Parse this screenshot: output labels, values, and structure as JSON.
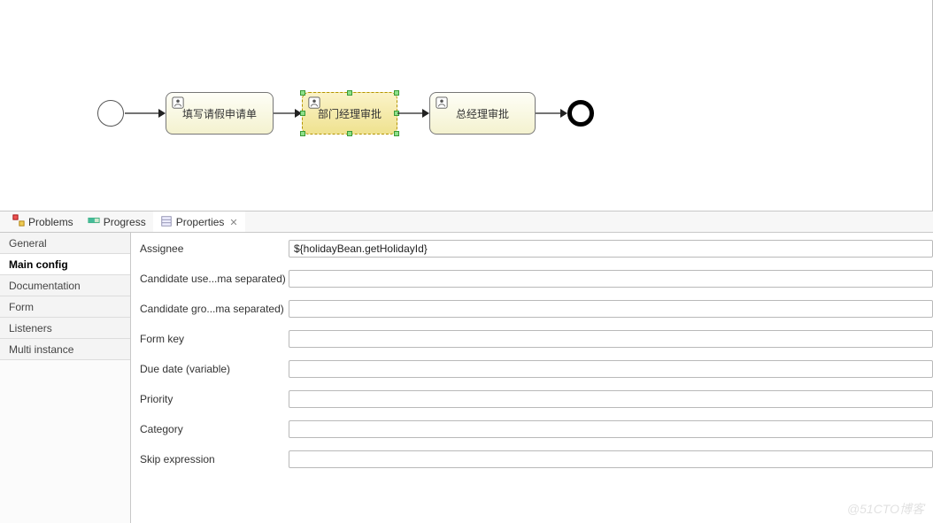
{
  "diagram": {
    "tasks": [
      {
        "id": "t1",
        "label": "填写请假申请单",
        "selected": false
      },
      {
        "id": "t2",
        "label": "部门经理审批",
        "selected": true
      },
      {
        "id": "t3",
        "label": "总经理审批",
        "selected": false
      }
    ]
  },
  "tabs": [
    {
      "id": "problems",
      "label": "Problems",
      "icon": "problems-icon"
    },
    {
      "id": "progress",
      "label": "Progress",
      "icon": "progress-icon"
    },
    {
      "id": "properties",
      "label": "Properties",
      "icon": "properties-icon",
      "active": true,
      "closable": true
    }
  ],
  "sidebar": {
    "items": [
      {
        "id": "general",
        "label": "General"
      },
      {
        "id": "main_config",
        "label": "Main config",
        "active": true
      },
      {
        "id": "documentation",
        "label": "Documentation"
      },
      {
        "id": "form",
        "label": "Form"
      },
      {
        "id": "listeners",
        "label": "Listeners"
      },
      {
        "id": "multi",
        "label": "Multi instance"
      }
    ]
  },
  "form": {
    "assignee": {
      "label": "Assignee",
      "value": "${holidayBean.getHolidayId}"
    },
    "candidate_users": {
      "label": "Candidate use...ma separated)",
      "value": ""
    },
    "candidate_groups": {
      "label": "Candidate gro...ma separated)",
      "value": ""
    },
    "form_key": {
      "label": "Form key",
      "value": ""
    },
    "due_date": {
      "label": "Due date (variable)",
      "value": ""
    },
    "priority": {
      "label": "Priority",
      "value": ""
    },
    "category": {
      "label": "Category",
      "value": ""
    },
    "skip_expression": {
      "label": "Skip expression",
      "value": ""
    }
  },
  "watermark": "@51CTO博客"
}
